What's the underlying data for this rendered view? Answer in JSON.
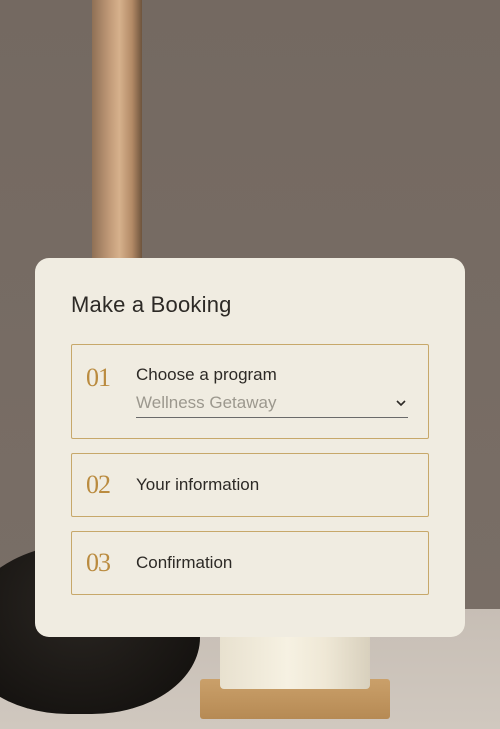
{
  "card": {
    "title": "Make a Booking"
  },
  "steps": [
    {
      "num": "01",
      "label": "Choose a program",
      "select": {
        "placeholder": "Wellness Getaway"
      }
    },
    {
      "num": "02",
      "label": "Your information"
    },
    {
      "num": "03",
      "label": "Confirmation"
    }
  ]
}
